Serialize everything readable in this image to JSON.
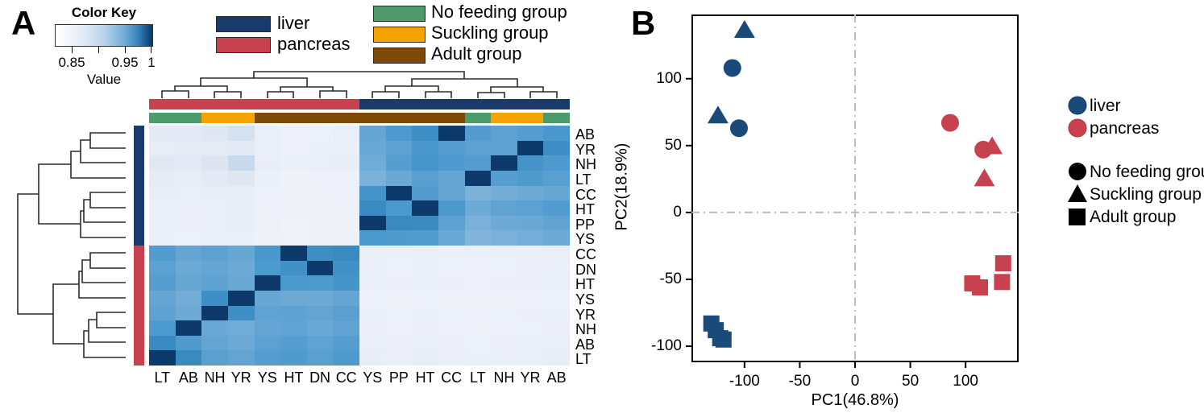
{
  "panelA": {
    "letter": "A",
    "color_key": {
      "title": "Color Key",
      "value_label": "Value",
      "ticks": [
        "0.85",
        "0.95",
        "1"
      ],
      "tick_values": [
        0.85,
        0.9,
        0.95,
        1.0
      ],
      "gradient_low": "#ffffff",
      "gradient_high": "#0d3a6b"
    },
    "tissue_legend": [
      {
        "label": "liver",
        "color": "#1a3a6b"
      },
      {
        "label": "pancreas",
        "color": "#c8414f"
      }
    ],
    "group_legend": [
      {
        "label": "No feeding group",
        "color": "#4d9a6a"
      },
      {
        "label": "Suckling group",
        "color": "#f5a300"
      },
      {
        "label": "Adult group",
        "color": "#7c4a06"
      }
    ],
    "column_labels": [
      "LT",
      "AB",
      "NH",
      "YR",
      "YS",
      "HT",
      "DN",
      "CC",
      "YS",
      "PP",
      "HT",
      "CC",
      "LT",
      "NH",
      "YR",
      "AB"
    ],
    "row_labels": [
      "AB",
      "YR",
      "NH",
      "LT",
      "CC",
      "HT",
      "PP",
      "YS",
      "CC",
      "DN",
      "HT",
      "YS",
      "YR",
      "NH",
      "AB",
      "LT"
    ],
    "column_tissue": [
      "pancreas",
      "pancreas",
      "pancreas",
      "pancreas",
      "pancreas",
      "pancreas",
      "pancreas",
      "pancreas",
      "liver",
      "liver",
      "liver",
      "liver",
      "liver",
      "liver",
      "liver",
      "liver"
    ],
    "column_group": [
      "No feeding group",
      "No feeding group",
      "Suckling group",
      "Suckling group",
      "Adult group",
      "Adult group",
      "Adult group",
      "Adult group",
      "Adult group",
      "Adult group",
      "Adult group",
      "Adult group",
      "No feeding group",
      "Suckling group",
      "Suckling group",
      "No feeding group"
    ],
    "row_tissue": [
      "liver",
      "liver",
      "liver",
      "liver",
      "liver",
      "liver",
      "liver",
      "liver",
      "pancreas",
      "pancreas",
      "pancreas",
      "pancreas",
      "pancreas",
      "pancreas",
      "pancreas",
      "pancreas"
    ]
  },
  "chart_data": [
    {
      "type": "heatmap",
      "title": "Color Key",
      "xlabel": "",
      "ylabel": "",
      "value_range": [
        0.82,
        1.0
      ],
      "colorbar_label": "Value",
      "x_categories": [
        "LT",
        "AB",
        "NH",
        "YR",
        "YS",
        "HT",
        "DN",
        "CC",
        "YS",
        "PP",
        "HT",
        "CC",
        "LT",
        "NH",
        "YR",
        "AB"
      ],
      "y_categories": [
        "AB",
        "YR",
        "NH",
        "LT",
        "CC",
        "HT",
        "PP",
        "YS",
        "CC",
        "DN",
        "HT",
        "YS",
        "YR",
        "NH",
        "AB",
        "LT"
      ],
      "values": [
        [
          0.872,
          0.871,
          0.878,
          0.888,
          0.862,
          0.857,
          0.858,
          0.861,
          0.94,
          0.95,
          0.958,
          1.0,
          0.948,
          0.944,
          0.947,
          0.952
        ],
        [
          0.866,
          0.868,
          0.87,
          0.873,
          0.861,
          0.857,
          0.86,
          0.86,
          0.938,
          0.944,
          0.952,
          0.947,
          0.944,
          0.943,
          1.0,
          0.958
        ],
        [
          0.875,
          0.873,
          0.882,
          0.894,
          0.865,
          0.86,
          0.861,
          0.864,
          0.935,
          0.946,
          0.954,
          0.95,
          0.947,
          1.0,
          0.955,
          0.95
        ],
        [
          0.868,
          0.867,
          0.871,
          0.878,
          0.86,
          0.855,
          0.857,
          0.858,
          0.93,
          0.938,
          0.945,
          0.94,
          1.0,
          0.946,
          0.949,
          0.945
        ],
        [
          0.863,
          0.861,
          0.864,
          0.866,
          0.858,
          0.855,
          0.856,
          0.857,
          0.955,
          1.0,
          0.948,
          0.941,
          0.93,
          0.934,
          0.937,
          0.939
        ],
        [
          0.862,
          0.86,
          0.862,
          0.864,
          0.857,
          0.854,
          0.856,
          0.856,
          0.962,
          0.951,
          1.0,
          0.951,
          0.936,
          0.942,
          0.944,
          0.948
        ],
        [
          0.861,
          0.859,
          0.861,
          0.863,
          0.856,
          0.853,
          0.855,
          0.855,
          1.0,
          0.962,
          0.961,
          0.944,
          0.931,
          0.936,
          0.938,
          0.942
        ],
        [
          0.86,
          0.858,
          0.86,
          0.862,
          0.855,
          0.853,
          0.854,
          0.855,
          0.951,
          0.949,
          0.948,
          0.938,
          0.927,
          0.931,
          0.933,
          0.937
        ],
        [
          0.948,
          0.94,
          0.944,
          0.939,
          0.952,
          1.0,
          0.958,
          0.962,
          0.862,
          0.86,
          0.862,
          0.86,
          0.859,
          0.86,
          0.861,
          0.862
        ],
        [
          0.944,
          0.937,
          0.94,
          0.936,
          0.95,
          0.957,
          1.0,
          0.957,
          0.86,
          0.858,
          0.86,
          0.858,
          0.857,
          0.858,
          0.859,
          0.86
        ],
        [
          0.946,
          0.939,
          0.943,
          0.938,
          1.0,
          0.951,
          0.95,
          0.955,
          0.861,
          0.859,
          0.861,
          0.859,
          0.858,
          0.859,
          0.86,
          0.861
        ],
        [
          0.94,
          0.934,
          0.958,
          1.0,
          0.939,
          0.937,
          0.936,
          0.94,
          0.858,
          0.856,
          0.858,
          0.856,
          0.855,
          0.856,
          0.857,
          0.858
        ],
        [
          0.943,
          0.937,
          1.0,
          0.958,
          0.942,
          0.943,
          0.941,
          0.945,
          0.86,
          0.858,
          0.86,
          0.858,
          0.857,
          0.858,
          0.859,
          0.86
        ],
        [
          0.95,
          1.0,
          0.938,
          0.935,
          0.94,
          0.942,
          0.938,
          0.942,
          0.859,
          0.857,
          0.859,
          0.857,
          0.856,
          0.857,
          0.858,
          0.859
        ],
        [
          0.962,
          0.949,
          0.941,
          0.937,
          0.944,
          0.946,
          0.942,
          0.947,
          0.861,
          0.859,
          0.861,
          0.859,
          0.858,
          0.859,
          0.86,
          0.861
        ],
        [
          1.0,
          0.962,
          0.945,
          0.941,
          0.947,
          0.949,
          0.945,
          0.95,
          0.863,
          0.861,
          0.863,
          0.861,
          0.86,
          0.861,
          0.862,
          0.863
        ]
      ]
    },
    {
      "type": "scatter",
      "title": "",
      "xlabel": "PC1(46.8%)",
      "ylabel": "PC2(18.9%)",
      "xlim": [
        -148,
        148
      ],
      "ylim": [
        -112,
        148
      ],
      "xticks": [
        -100,
        -50,
        0,
        50,
        100
      ],
      "yticks": [
        -100,
        -50,
        0,
        50,
        100
      ],
      "grid": false,
      "reference_lines": {
        "x": 0,
        "y": 0,
        "style": "dash-dot",
        "color": "#bdbdbd"
      },
      "legend_position": "right",
      "color_legend": [
        {
          "label": "liver",
          "color": "#1a4a7a"
        },
        {
          "label": "pancreas",
          "color": "#c8414f"
        }
      ],
      "shape_legend": [
        {
          "label": "No feeding group",
          "shape": "circle"
        },
        {
          "label": "Suckling group",
          "shape": "triangle"
        },
        {
          "label": "Adult group",
          "shape": "square"
        }
      ],
      "series": [
        {
          "name": "liver",
          "color": "#1a4a7a",
          "points": [
            {
              "x": -111,
              "y": 108,
              "shape": "circle"
            },
            {
              "x": -105,
              "y": 63,
              "shape": "circle"
            },
            {
              "x": -100,
              "y": 136,
              "shape": "triangle"
            },
            {
              "x": -124,
              "y": 72,
              "shape": "triangle"
            },
            {
              "x": -130,
              "y": -83,
              "shape": "square"
            },
            {
              "x": -122,
              "y": -94,
              "shape": "square"
            },
            {
              "x": -119,
              "y": -95,
              "shape": "square"
            },
            {
              "x": -126,
              "y": -88,
              "shape": "square"
            }
          ]
        },
        {
          "name": "pancreas",
          "color": "#c8414f",
          "points": [
            {
              "x": 86,
              "y": 67,
              "shape": "circle"
            },
            {
              "x": 116,
              "y": 47,
              "shape": "circle"
            },
            {
              "x": 124,
              "y": 49,
              "shape": "triangle"
            },
            {
              "x": 117,
              "y": 25,
              "shape": "triangle"
            },
            {
              "x": 134,
              "y": -38,
              "shape": "square"
            },
            {
              "x": 133,
              "y": -52,
              "shape": "square"
            },
            {
              "x": 106,
              "y": -53,
              "shape": "square"
            },
            {
              "x": 113,
              "y": -56,
              "shape": "square"
            }
          ]
        }
      ]
    }
  ],
  "panelB": {
    "letter": "B",
    "xlabel": "PC1(46.8%)",
    "ylabel": "PC2(18.9%)",
    "xticks": [
      "-100",
      "-50",
      "0",
      "50",
      "100"
    ],
    "yticks": [
      "100",
      "50",
      "0",
      "-50",
      "-100"
    ],
    "color_legend": [
      {
        "label": "liver",
        "color": "#1a4a7a"
      },
      {
        "label": "pancreas",
        "color": "#c8414f"
      }
    ],
    "shape_legend": [
      {
        "label": "No feeding group",
        "shape": "circle"
      },
      {
        "label": "Suckling group",
        "shape": "triangle"
      },
      {
        "label": "Adult group",
        "shape": "square"
      }
    ]
  }
}
